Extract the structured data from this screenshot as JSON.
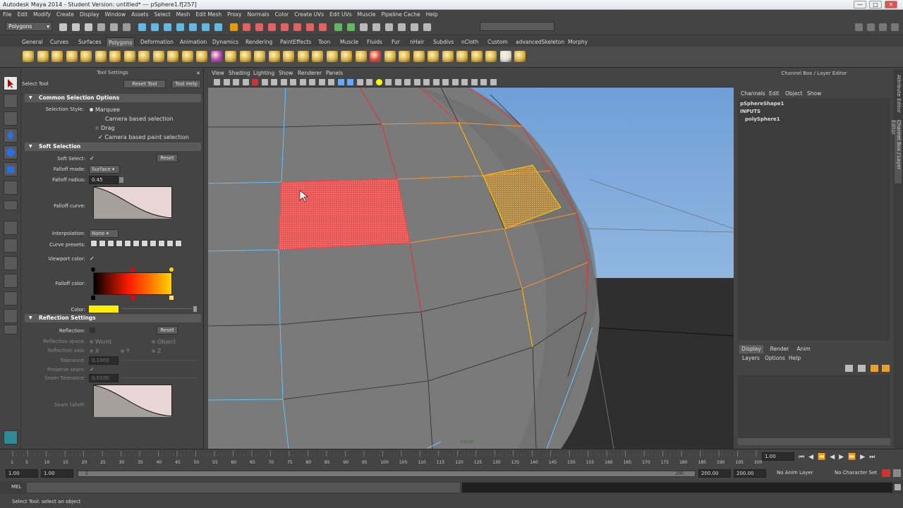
{
  "title_bar": {
    "title": "Autodesk Maya 2014 - Student Version: untitled*   ---   pSphere1.f[257]"
  },
  "menu": [
    "File",
    "Edit",
    "Modify",
    "Create",
    "Display",
    "Window",
    "Assets",
    "Select",
    "Mesh",
    "Edit Mesh",
    "Proxy",
    "Normals",
    "Color",
    "Create UVs",
    "Edit UVs",
    "Muscle",
    "Pipeline Cache",
    "Help"
  ],
  "status_line": {
    "mode": "Polygons"
  },
  "shelf_tabs": [
    "General",
    "Curves",
    "Surfaces",
    "Polygons",
    "Deformation",
    "Animation",
    "Dynamics",
    "Rendering",
    "PaintEffects",
    "Toon",
    "Muscle",
    "Fluids",
    "Fur",
    "nHair",
    "Subdivs",
    "nCloth",
    "Custom",
    "advancedSkeleton",
    "Morphy"
  ],
  "shelf_active": "Polygons",
  "tool_settings": {
    "header": "Tool Settings",
    "tool_name": "Select Tool",
    "reset_tool": "Reset Tool",
    "tool_help": "Tool Help",
    "common": {
      "section": "Common Selection Options",
      "selection_style_label": "Selection Style:",
      "marquee": "Marquee",
      "camera_based_selection": "Camera based selection",
      "drag": "Drag",
      "camera_based_paint": "Camera based paint selection"
    },
    "soft": {
      "section": "Soft Selection",
      "soft_select_label": "Soft Select:",
      "reset": "Reset",
      "falloff_mode_label": "Falloff mode:",
      "falloff_mode": "Surface",
      "falloff_radius_label": "Falloff radius:",
      "falloff_radius": "0.45",
      "falloff_curve_label": "Falloff curve:",
      "interpolation_label": "Interpolation:",
      "interpolation": "None",
      "curve_presets_label": "Curve presets:",
      "viewport_color_label": "Viewport color:",
      "falloff_color_label": "Falloff color:",
      "color_label": "Color:"
    },
    "reflection": {
      "section": "Reflection Settings",
      "reflection_label": "Reflection:",
      "reset": "Reset",
      "space_label": "Reflection space:",
      "world": "World",
      "object": "Object",
      "axis_label": "Reflection axis:",
      "x": "X",
      "y": "Y",
      "z": "Z",
      "tolerance_label": "Tolerance:",
      "tolerance": "0.1000",
      "preserve_seam_label": "Preserve seam:",
      "seam_tolerance_label": "Seam Tolerance:",
      "seam_tolerance": "0.0100",
      "seam_falloff_label": "Seam falloff:"
    }
  },
  "viewport": {
    "menu": [
      "View",
      "Shading",
      "Lighting",
      "Show",
      "Renderer",
      "Panels"
    ],
    "camera_label": "persp"
  },
  "channel_box": {
    "header": "Channel Box / Layer Editor",
    "menu": [
      "Channels",
      "Edit",
      "Object",
      "Show"
    ],
    "shape": "pSphereShape1",
    "inputs": "INPUTS",
    "input_node": "polySphere1",
    "layer_tabs": [
      "Display",
      "Render",
      "Anim"
    ],
    "layer_menu": [
      "Layers",
      "Options",
      "Help"
    ]
  },
  "side_tabs": [
    "Attribute Editor",
    "Channel Box / Layer Editor"
  ],
  "time_slider": {
    "ticks": [
      "1",
      "5",
      "10",
      "15",
      "20",
      "25",
      "30",
      "35",
      "40",
      "45",
      "50",
      "55",
      "60",
      "65",
      "70",
      "75",
      "80",
      "85",
      "90",
      "95",
      "100",
      "105",
      "110",
      "115",
      "120",
      "125",
      "130",
      "135",
      "140",
      "145",
      "150",
      "155",
      "160",
      "165",
      "170",
      "175",
      "180",
      "185",
      "190",
      "195",
      "200"
    ],
    "current": "1.00"
  },
  "range_slider": {
    "start": "1.00",
    "inner_start": "1.00",
    "inner_start_marker": "1",
    "inner_end": "200",
    "end1": "200.00",
    "end2": "200.00",
    "anim_layer": "No Anim Layer",
    "char_set": "No Character Set"
  },
  "command_line": {
    "label": "MEL"
  },
  "help_line": {
    "text": "Select Tool: select an object"
  },
  "colors": {
    "accent": "#5a5a5a",
    "soft_yellow": "#ffee00",
    "selection_red": "#e04040",
    "sky_top": "#7aa8d8",
    "sky_bottom": "#a9c8e8"
  }
}
